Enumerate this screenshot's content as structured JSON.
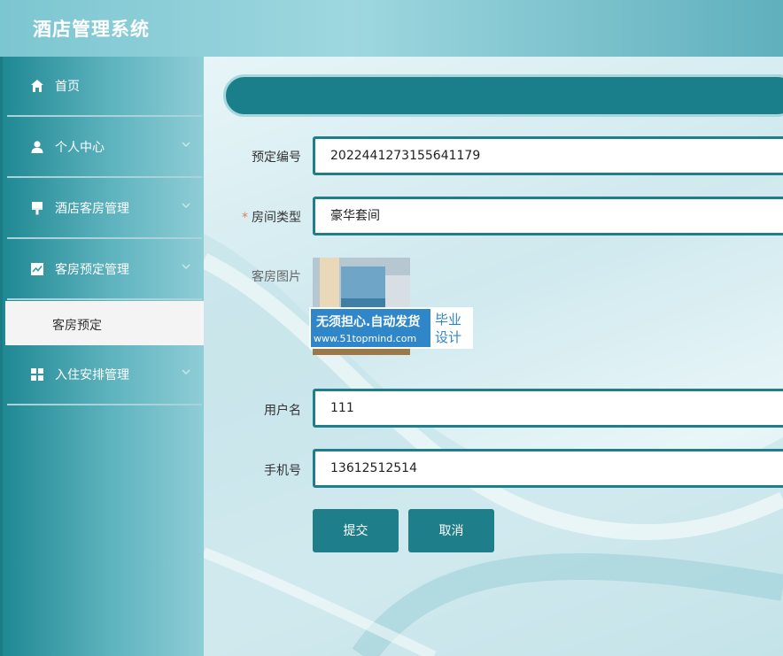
{
  "app": {
    "title": "酒店管理系统"
  },
  "sidebar": {
    "items": [
      {
        "label": "首页",
        "icon": "home-icon"
      },
      {
        "label": "个人中心",
        "icon": "user-icon"
      },
      {
        "label": "酒店客房管理",
        "icon": "brush-icon"
      },
      {
        "label": "客房预定管理",
        "icon": "chart-icon"
      },
      {
        "label": "入住安排管理",
        "icon": "grid-icon"
      }
    ],
    "active_sub": {
      "label": "客房预定"
    }
  },
  "form": {
    "booking_no": {
      "label": "预定编号",
      "value": "2022441273155641179"
    },
    "room_type": {
      "label": "房间类型",
      "value": "豪华套间",
      "required": "*"
    },
    "room_image": {
      "label": "客房图片"
    },
    "username": {
      "label": "用户名",
      "value": "111"
    },
    "phone": {
      "label": "手机号",
      "value": "13612512514"
    },
    "submit_label": "提交",
    "cancel_label": "取消"
  },
  "watermark": {
    "line1": "无须担心.自动发货",
    "line2": "www.51topmind.com",
    "box_line1": "毕业",
    "box_line2": "设计"
  },
  "colors": {
    "accent": "#1e7f8a",
    "sidebar_dark": "#1f8893",
    "topbar": "#7cc6d1"
  }
}
